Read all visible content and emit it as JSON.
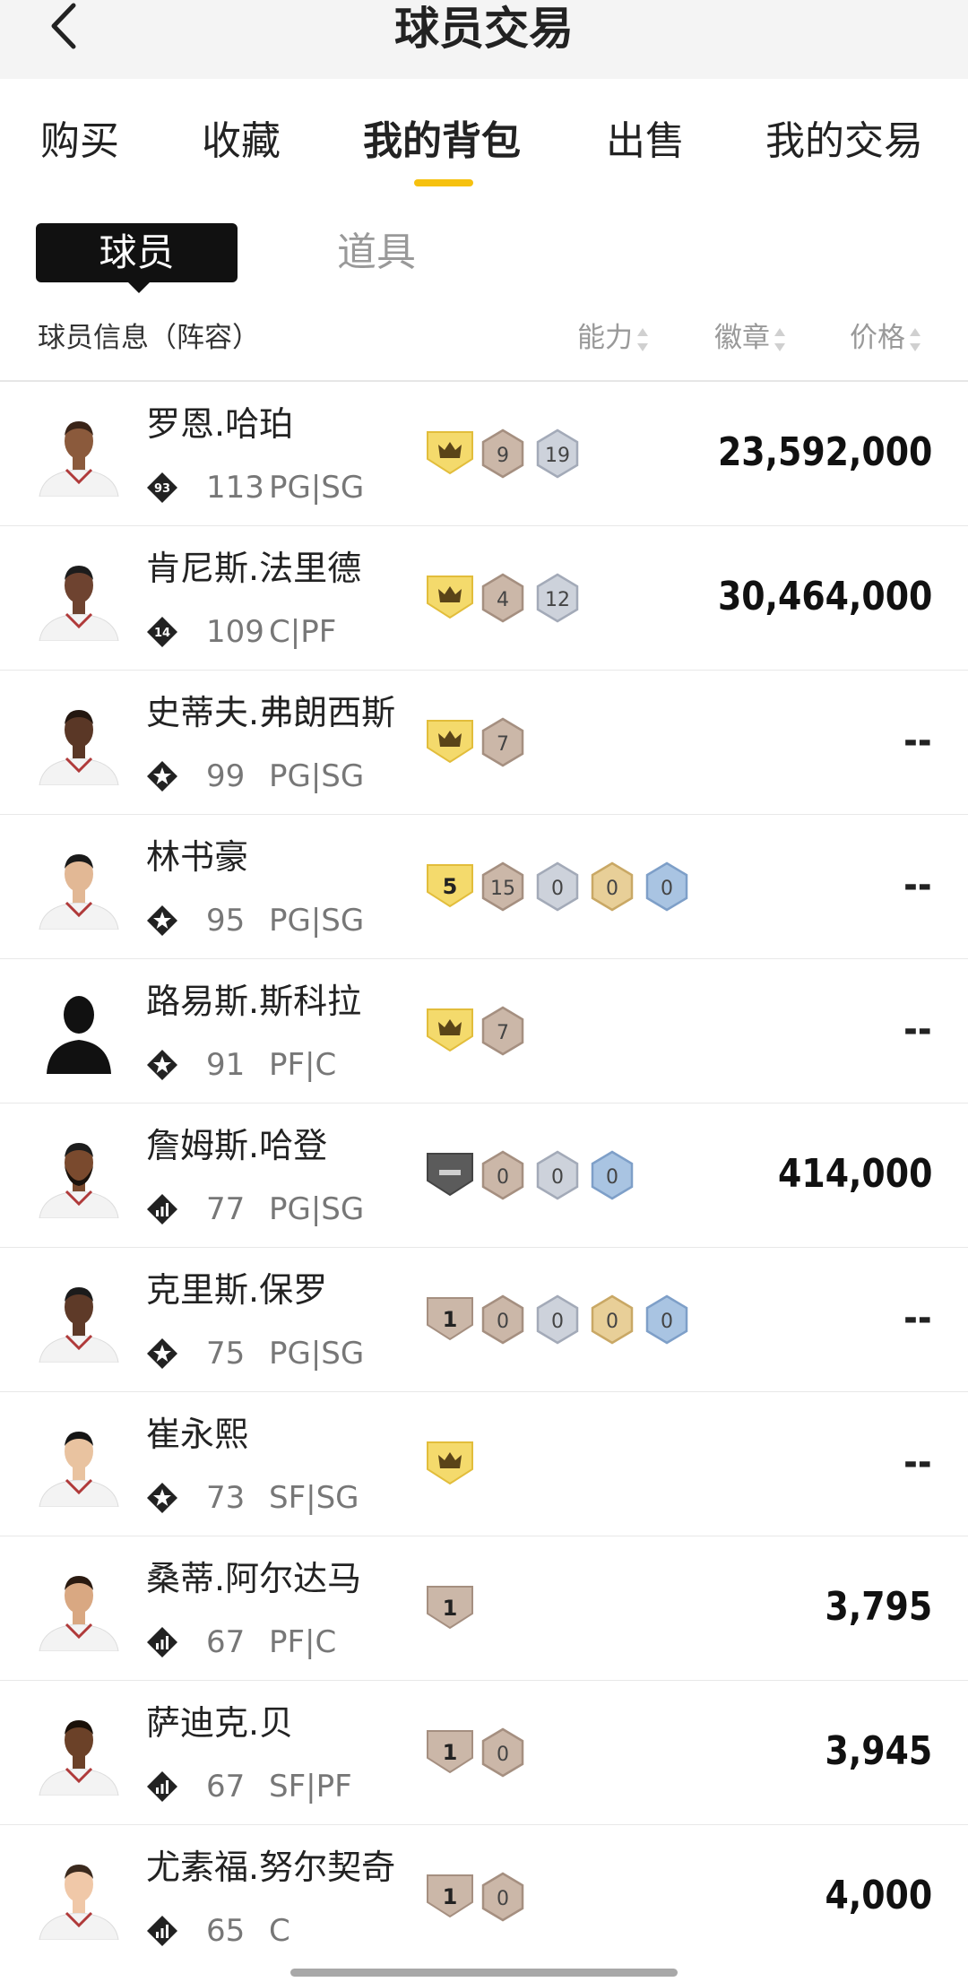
{
  "header": {
    "title": "球员交易"
  },
  "tabs": [
    {
      "label": "购买",
      "active": false
    },
    {
      "label": "收藏",
      "active": false
    },
    {
      "label": "我的背包",
      "active": true
    },
    {
      "label": "出售",
      "active": false
    },
    {
      "label": "我的交易",
      "active": false
    }
  ],
  "segment": {
    "players": "球员",
    "items": "道具",
    "selected": "球员"
  },
  "columns": {
    "info": "球员信息（阵容）",
    "ability": "能力",
    "badges": "徽章",
    "price": "价格"
  },
  "colors": {
    "accent": "#f6c10f",
    "text": "#1a1a1a",
    "muted": "#777777",
    "badge_yellow": "#f3d86b",
    "badge_bronze": "#c9b6a7",
    "badge_silver": "#c6cbd5",
    "badge_gold": "#e6c98d",
    "badge_blue": "#9dbbdd"
  },
  "players": [
    {
      "name": "罗恩.哈珀",
      "tier": "93",
      "tier_icon": "number-diamond-icon",
      "ovr": "113",
      "pos": "PG|SG",
      "avatar": "player-photo",
      "badges": [
        {
          "type": "crown",
          "label": ""
        },
        {
          "type": "bronze",
          "label": "9"
        },
        {
          "type": "silver",
          "label": "19"
        }
      ],
      "price": "23,592,000"
    },
    {
      "name": "肯尼斯.法里德",
      "tier": "14",
      "tier_icon": "number-diamond-icon",
      "ovr": "109",
      "pos": "C|PF",
      "avatar": "player-photo",
      "badges": [
        {
          "type": "crown",
          "label": ""
        },
        {
          "type": "bronze",
          "label": "4"
        },
        {
          "type": "silver",
          "label": "12"
        }
      ],
      "price": "30,464,000"
    },
    {
      "name": "史蒂夫.弗朗西斯",
      "tier": "",
      "tier_icon": "star-diamond-icon",
      "ovr": "99",
      "pos": "PG|SG",
      "avatar": "player-photo",
      "badges": [
        {
          "type": "crown",
          "label": ""
        },
        {
          "type": "bronze",
          "label": "7"
        }
      ],
      "price": "--"
    },
    {
      "name": "林书豪",
      "tier": "",
      "tier_icon": "star-diamond-icon",
      "ovr": "95",
      "pos": "PG|SG",
      "avatar": "player-photo",
      "badges": [
        {
          "type": "level-yellow",
          "label": "5"
        },
        {
          "type": "bronze",
          "label": "15"
        },
        {
          "type": "silver",
          "label": "0"
        },
        {
          "type": "gold",
          "label": "0"
        },
        {
          "type": "blue",
          "label": "0"
        }
      ],
      "price": "--"
    },
    {
      "name": "路易斯.斯科拉",
      "tier": "",
      "tier_icon": "star-diamond-icon",
      "ovr": "91",
      "pos": "PF|C",
      "avatar": "silhouette",
      "badges": [
        {
          "type": "crown",
          "label": ""
        },
        {
          "type": "bronze",
          "label": "7"
        }
      ],
      "price": "--"
    },
    {
      "name": "詹姆斯.哈登",
      "tier": "",
      "tier_icon": "bars-diamond-icon",
      "ovr": "77",
      "pos": "PG|SG",
      "avatar": "player-photo",
      "badges": [
        {
          "type": "dash",
          "label": ""
        },
        {
          "type": "bronze",
          "label": "0"
        },
        {
          "type": "silver",
          "label": "0"
        },
        {
          "type": "blue",
          "label": "0"
        }
      ],
      "price": "414,000"
    },
    {
      "name": "克里斯.保罗",
      "tier": "",
      "tier_icon": "star-diamond-icon",
      "ovr": "75",
      "pos": "PG|SG",
      "avatar": "player-photo",
      "badges": [
        {
          "type": "level-bronze",
          "label": "1"
        },
        {
          "type": "bronze",
          "label": "0"
        },
        {
          "type": "silver",
          "label": "0"
        },
        {
          "type": "gold",
          "label": "0"
        },
        {
          "type": "blue",
          "label": "0"
        }
      ],
      "price": "--"
    },
    {
      "name": "崔永熙",
      "tier": "",
      "tier_icon": "star-diamond-icon",
      "ovr": "73",
      "pos": "SF|SG",
      "avatar": "player-photo",
      "badges": [
        {
          "type": "crown",
          "label": ""
        }
      ],
      "price": "--"
    },
    {
      "name": "桑蒂.阿尔达马",
      "tier": "",
      "tier_icon": "bars-diamond-icon",
      "ovr": "67",
      "pos": "PF|C",
      "avatar": "player-photo",
      "badges": [
        {
          "type": "level-bronze",
          "label": "1"
        }
      ],
      "price": "3,795"
    },
    {
      "name": "萨迪克.贝",
      "tier": "",
      "tier_icon": "bars-diamond-icon",
      "ovr": "67",
      "pos": "SF|PF",
      "avatar": "player-photo",
      "badges": [
        {
          "type": "level-bronze",
          "label": "1"
        },
        {
          "type": "bronze",
          "label": "0"
        }
      ],
      "price": "3,945"
    },
    {
      "name": "尤素福.努尔契奇",
      "tier": "",
      "tier_icon": "bars-diamond-icon",
      "ovr": "65",
      "pos": "C",
      "avatar": "player-photo",
      "badges": [
        {
          "type": "level-bronze",
          "label": "1"
        },
        {
          "type": "bronze",
          "label": "0"
        }
      ],
      "price": "4,000"
    }
  ]
}
